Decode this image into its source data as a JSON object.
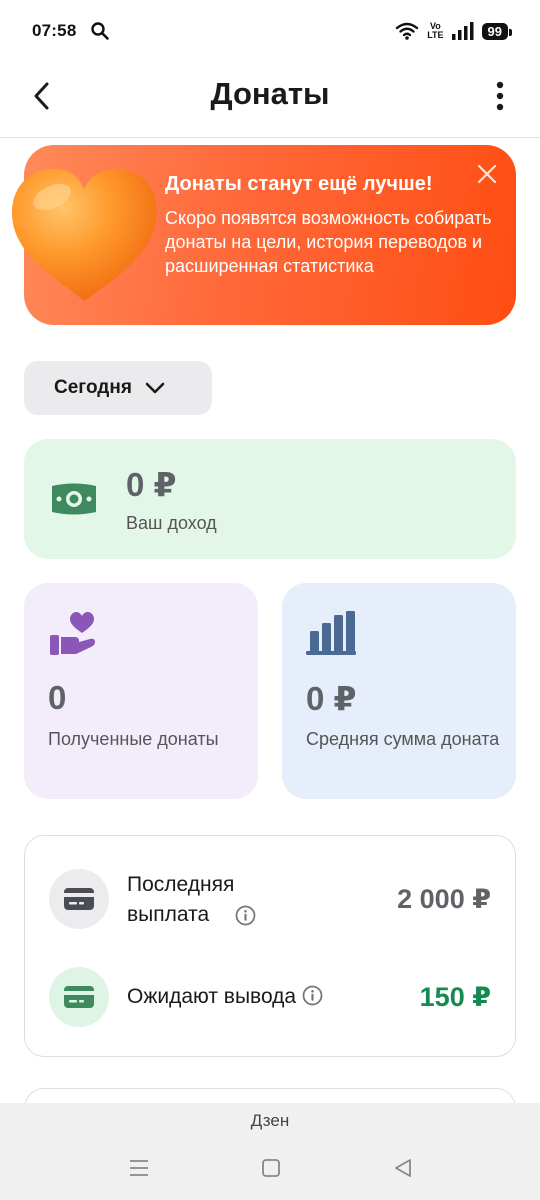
{
  "status_bar": {
    "time": "07:58",
    "volte_top": "Vo",
    "volte_bottom": "LTE",
    "battery": "99"
  },
  "header": {
    "title": "Донаты",
    "back_icon": "chevron-left-icon",
    "menu_icon": "more-vertical-icon"
  },
  "promo": {
    "title": "Донаты станут ещё лучше!",
    "text": "Скоро появятся возможность собирать донаты на цели, история переводов и расширенная статистика",
    "close_icon": "close-icon",
    "heart_icon": "heart-icon",
    "gradient_start": "#ff8a5a",
    "gradient_end": "#ff4d12"
  },
  "period": {
    "label": "Сегодня",
    "icon": "chevron-down-icon"
  },
  "income": {
    "value": "0 ₽",
    "label": "Ваш доход",
    "icon": "cash-icon",
    "background": "#e3f7e9"
  },
  "stats": {
    "received": {
      "value": "0",
      "label": "Полученные донаты",
      "icon": "hand-heart-icon",
      "background": "#f3ecfa"
    },
    "average": {
      "value": "0 ₽",
      "label": "Средняя сумма доната",
      "icon": "bar-chart-icon",
      "background": "#e6eefb"
    }
  },
  "payouts": {
    "last": {
      "label": "Последняя выплата",
      "amount": "2 000 ₽",
      "icon": "card-icon"
    },
    "pending": {
      "label": "Ожидают вывода",
      "amount": "150 ₽",
      "icon": "card-icon",
      "amount_color": "#138a50"
    }
  },
  "bottom": {
    "label": "Дзен"
  },
  "nav": {
    "menu_icon": "menu-icon",
    "home_icon": "home-square-icon",
    "back_icon": "back-triangle-icon"
  }
}
